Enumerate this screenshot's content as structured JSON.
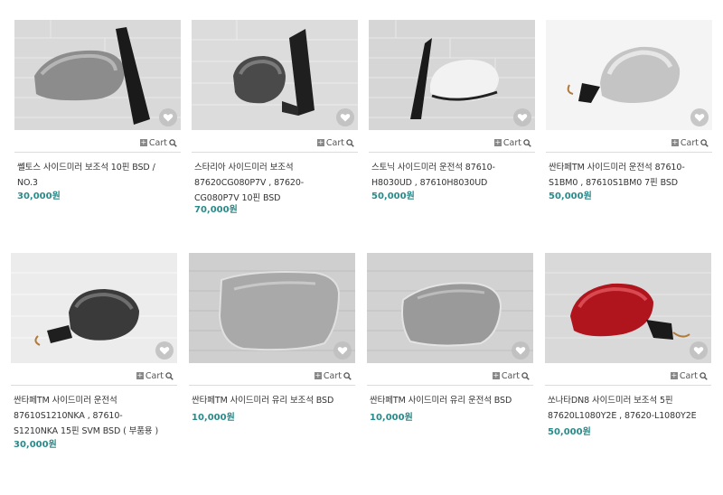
{
  "colors": {
    "price": "#2a8a8a",
    "heart_bg": "#bdbdbd"
  },
  "products": [
    {
      "title_lines": [
        "쏄토스 사이드미러 보조석 10핀 BSD /",
        "NO.3"
      ],
      "price": "30,000원",
      "cart_label": "Cart",
      "icon": "heart-icon"
    },
    {
      "title_lines": [
        "스타리아 사이드미러 보조석",
        "87620CG080P7V , 87620-",
        "CG080P7V 10핀 BSD"
      ],
      "price": "70,000원",
      "cart_label": "Cart",
      "icon": "heart-icon"
    },
    {
      "title_lines": [
        "스토닉 사이드미러 운전석 87610-",
        "H8030UD , 87610H8030UD"
      ],
      "price": "50,000원",
      "cart_label": "Cart",
      "icon": "heart-icon"
    },
    {
      "title_lines": [
        "싼타페TM 사이드미러 운전석 87610-",
        "S1BM0 , 87610S1BM0 7핀 BSD"
      ],
      "price": "50,000원",
      "cart_label": "Cart",
      "icon": "heart-icon"
    },
    {
      "title_lines": [
        "싼타페TM 사이드미러 운전석",
        "87610S1210NKA , 87610-",
        "S1210NKA 15핀 SVM BSD ( 부품용 )"
      ],
      "price": "30,000원",
      "cart_label": "Cart",
      "icon": "heart-icon"
    },
    {
      "title_lines": [
        "싼타페TM 사이드미러 유리 보조석 BSD"
      ],
      "price": "10,000원",
      "cart_label": "Cart",
      "icon": "heart-icon"
    },
    {
      "title_lines": [
        "싼타페TM 사이드미러 유리 운전석 BSD"
      ],
      "price": "10,000원",
      "cart_label": "Cart",
      "icon": "heart-icon"
    },
    {
      "title_lines": [
        "쏘나타DN8 사이드미러 보조석 5핀",
        "87620L1080Y2E , 87620-L1080Y2E"
      ],
      "price": "50,000원",
      "cart_label": "Cart",
      "icon": "heart-icon"
    }
  ]
}
